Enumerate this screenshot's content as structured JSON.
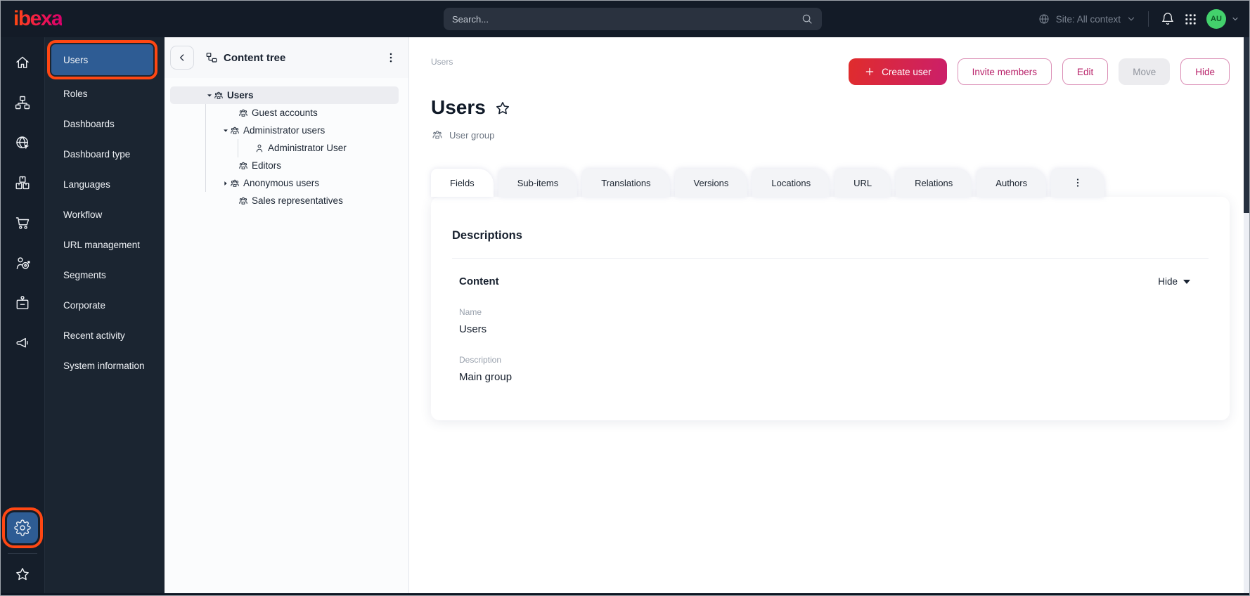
{
  "colors": {
    "topbar_bg": "#131b27",
    "rail_bg": "#151e2a",
    "sidebar_bg": "#1b2531",
    "highlight_orange": "#ff4713",
    "selected_blue": "#2e5c94",
    "primary_gradient_start": "#e02c2c",
    "primary_gradient_end": "#cb1f6a",
    "pink_button_text": "#b82169",
    "avatar_green": "#43d16c"
  },
  "topbar": {
    "logo_text": "ibexa",
    "search": {
      "placeholder": "Search...",
      "icon": "search"
    },
    "site_context": {
      "icon": "globe-sm",
      "label": "Site: All context",
      "caret_icon": "chevron-down"
    },
    "notifications_icon": "bell",
    "apps_icon": "grid",
    "avatar": {
      "initials": "AU",
      "caret_icon": "chevron-down"
    }
  },
  "icon_rail": {
    "top_items": [
      {
        "name": "home",
        "icon": "home"
      },
      {
        "name": "content-structure",
        "icon": "sitemap"
      },
      {
        "name": "site",
        "icon": "globe-site"
      },
      {
        "name": "products",
        "icon": "packages"
      },
      {
        "name": "commerce",
        "icon": "cart"
      },
      {
        "name": "personalization",
        "icon": "personalization"
      },
      {
        "name": "corporate",
        "icon": "badge"
      },
      {
        "name": "marketing",
        "icon": "megaphone"
      }
    ],
    "bottom_items": [
      {
        "name": "admin-settings",
        "icon": "gear",
        "selected": true,
        "highlighted": true
      },
      {
        "name": "bookmarks",
        "icon": "star"
      }
    ]
  },
  "sidebar": {
    "items": [
      {
        "label": "Users",
        "selected": true,
        "highlighted": true
      },
      {
        "label": "Roles"
      },
      {
        "label": "Dashboards"
      },
      {
        "label": "Dashboard type"
      },
      {
        "label": "Languages"
      },
      {
        "label": "Workflow"
      },
      {
        "label": "URL management"
      },
      {
        "label": "Segments"
      },
      {
        "label": "Corporate"
      },
      {
        "label": "Recent activity"
      },
      {
        "label": "System information"
      }
    ]
  },
  "content_tree": {
    "title": "Content tree",
    "collapse_icon": "chevron-left",
    "tree_icon": "tree-glyph",
    "menu_icon": "kebab",
    "items": [
      {
        "label": "Users",
        "level": 0,
        "caret": "down",
        "icon": "user-group",
        "selected": true
      },
      {
        "label": "Guest accounts",
        "level": 1,
        "caret": "none",
        "icon": "user-group"
      },
      {
        "label": "Administrator users",
        "level": 1,
        "caret": "down",
        "icon": "user-group"
      },
      {
        "label": "Administrator User",
        "level": 2,
        "caret": "none",
        "icon": "user"
      },
      {
        "label": "Editors",
        "level": 1,
        "caret": "none",
        "icon": "user-group"
      },
      {
        "label": "Anonymous users",
        "level": 1,
        "caret": "right",
        "icon": "user-group"
      },
      {
        "label": "Sales representatives",
        "level": 1,
        "caret": "none",
        "icon": "user-group"
      }
    ]
  },
  "main": {
    "breadcrumb": "Users",
    "title": "Users",
    "favorite_icon": "star",
    "content_type": {
      "icon": "user-group",
      "label": "User group"
    },
    "actions": [
      {
        "id": "create-user",
        "label": "Create user",
        "variant": "primary",
        "icon": "plus"
      },
      {
        "id": "invite-members",
        "label": "Invite members",
        "variant": "outline"
      },
      {
        "id": "edit",
        "label": "Edit",
        "variant": "outline"
      },
      {
        "id": "move",
        "label": "Move",
        "variant": "disabled"
      },
      {
        "id": "hide",
        "label": "Hide",
        "variant": "outline"
      }
    ],
    "tabs": [
      {
        "label": "Fields",
        "active": true
      },
      {
        "label": "Sub-items"
      },
      {
        "label": "Translations"
      },
      {
        "label": "Versions"
      },
      {
        "label": "Locations"
      },
      {
        "label": "URL"
      },
      {
        "label": "Relations"
      },
      {
        "label": "Authors"
      }
    ],
    "tabs_more_icon": "kebab",
    "card": {
      "section_title": "Descriptions",
      "group": {
        "title": "Content",
        "collapse_label": "Hide",
        "collapse_icon": "caret-down"
      },
      "fields": [
        {
          "label": "Name",
          "value": "Users"
        },
        {
          "label": "Description",
          "value": "Main group"
        }
      ]
    }
  }
}
